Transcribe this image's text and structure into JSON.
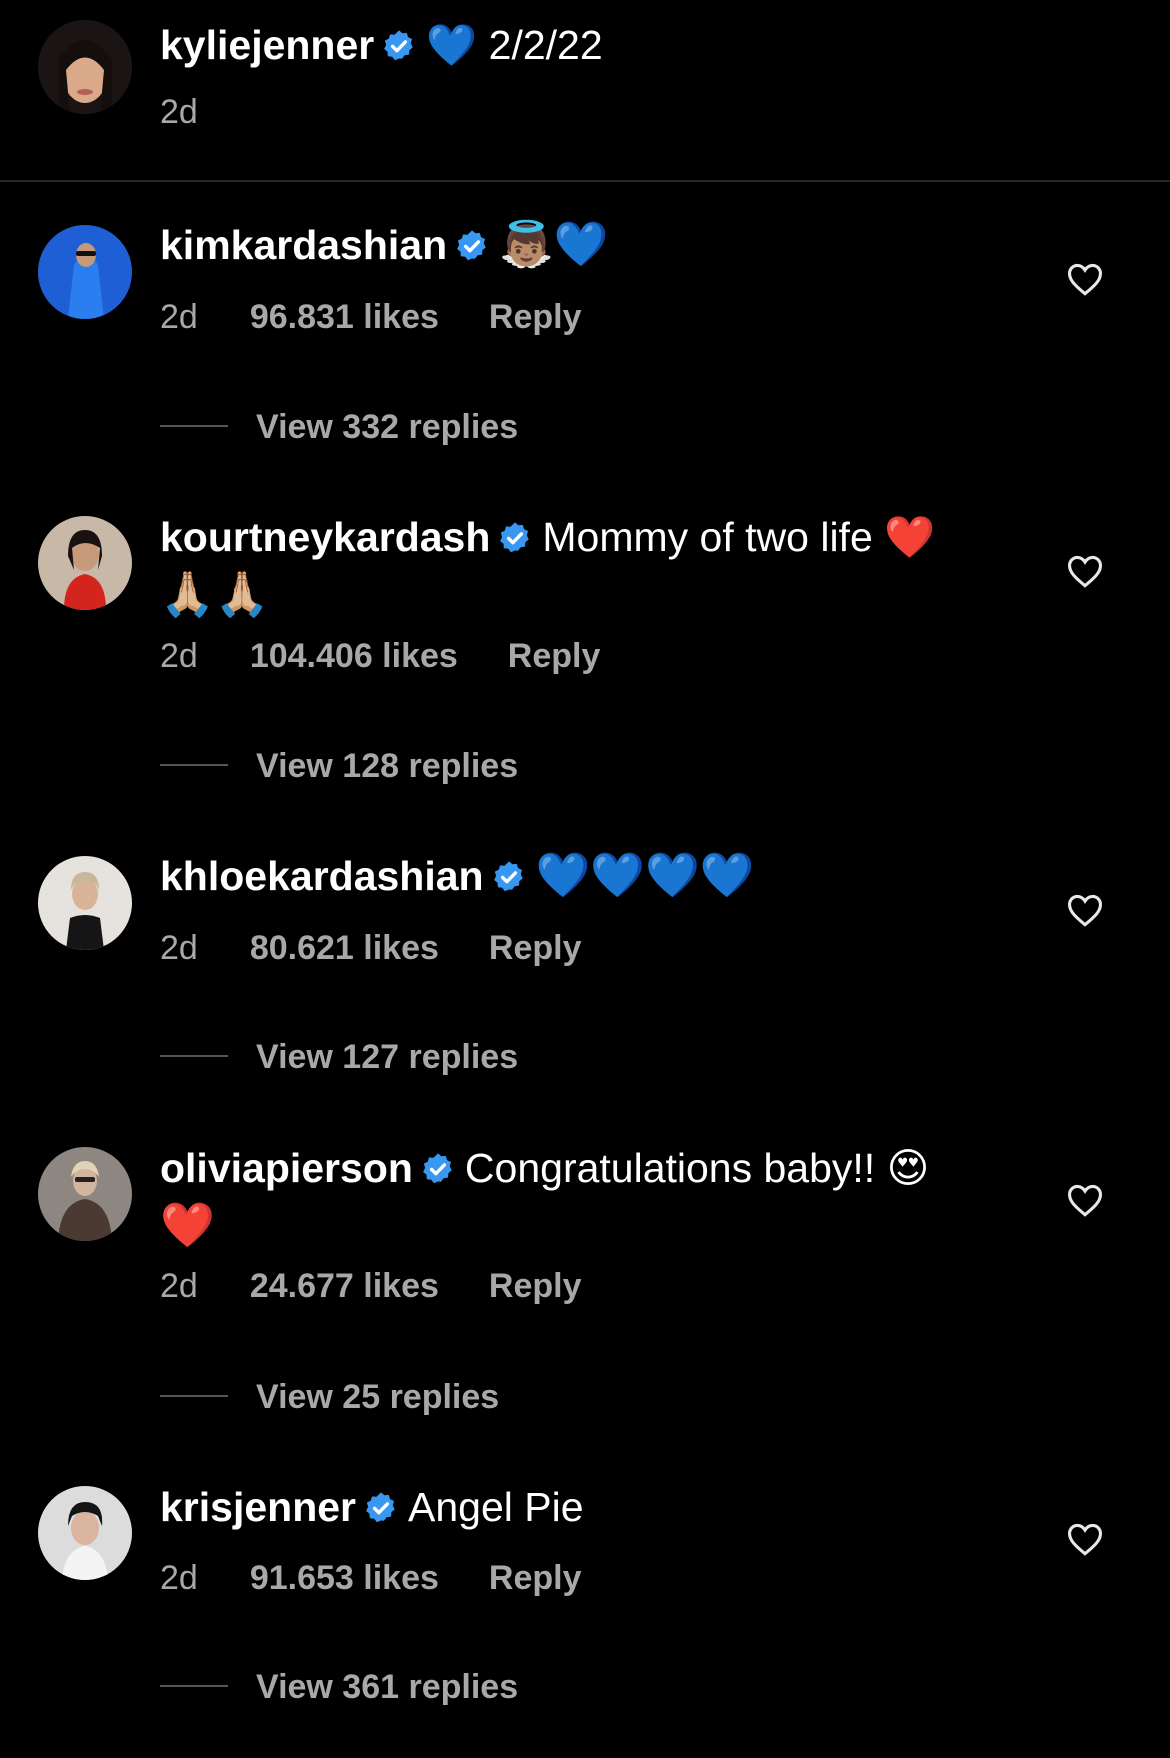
{
  "caption": {
    "username": "kyliejenner",
    "text": "💙 2/2/22",
    "age": "2d"
  },
  "comments": [
    {
      "username": "kimkardashian",
      "text": "👼🏽💙",
      "age": "2d",
      "likes": "96.831 likes",
      "reply": "Reply",
      "view_replies": "View 332 replies"
    },
    {
      "username": "kourtneykardash",
      "text_line1": "Mommy of two life ❤️",
      "text_line2": "🙏🏼🙏🏼",
      "age": "2d",
      "likes": "104.406 likes",
      "reply": "Reply",
      "view_replies": "View 128 replies"
    },
    {
      "username": "khloekardashian",
      "text": "💙💙💙💙",
      "age": "2d",
      "likes": "80.621 likes",
      "reply": "Reply",
      "view_replies": "View 127 replies"
    },
    {
      "username": "oliviapierson",
      "text_line1": "Congratulations baby!! 😍",
      "text_line2": "❤️",
      "age": "2d",
      "likes": "24.677 likes",
      "reply": "Reply",
      "view_replies": "View 25 replies"
    },
    {
      "username": "krisjenner",
      "text": "Angel Pie",
      "age": "2d",
      "likes": "91.653 likes",
      "reply": "Reply",
      "view_replies": "View 361 replies"
    }
  ],
  "colors": {
    "background": "#000000",
    "secondary_text": "#a8a8a8",
    "verified_badge": "#3897f0",
    "divider": "#262626"
  },
  "icons": {
    "verified": "verified-badge-icon",
    "like": "heart-outline-icon"
  }
}
